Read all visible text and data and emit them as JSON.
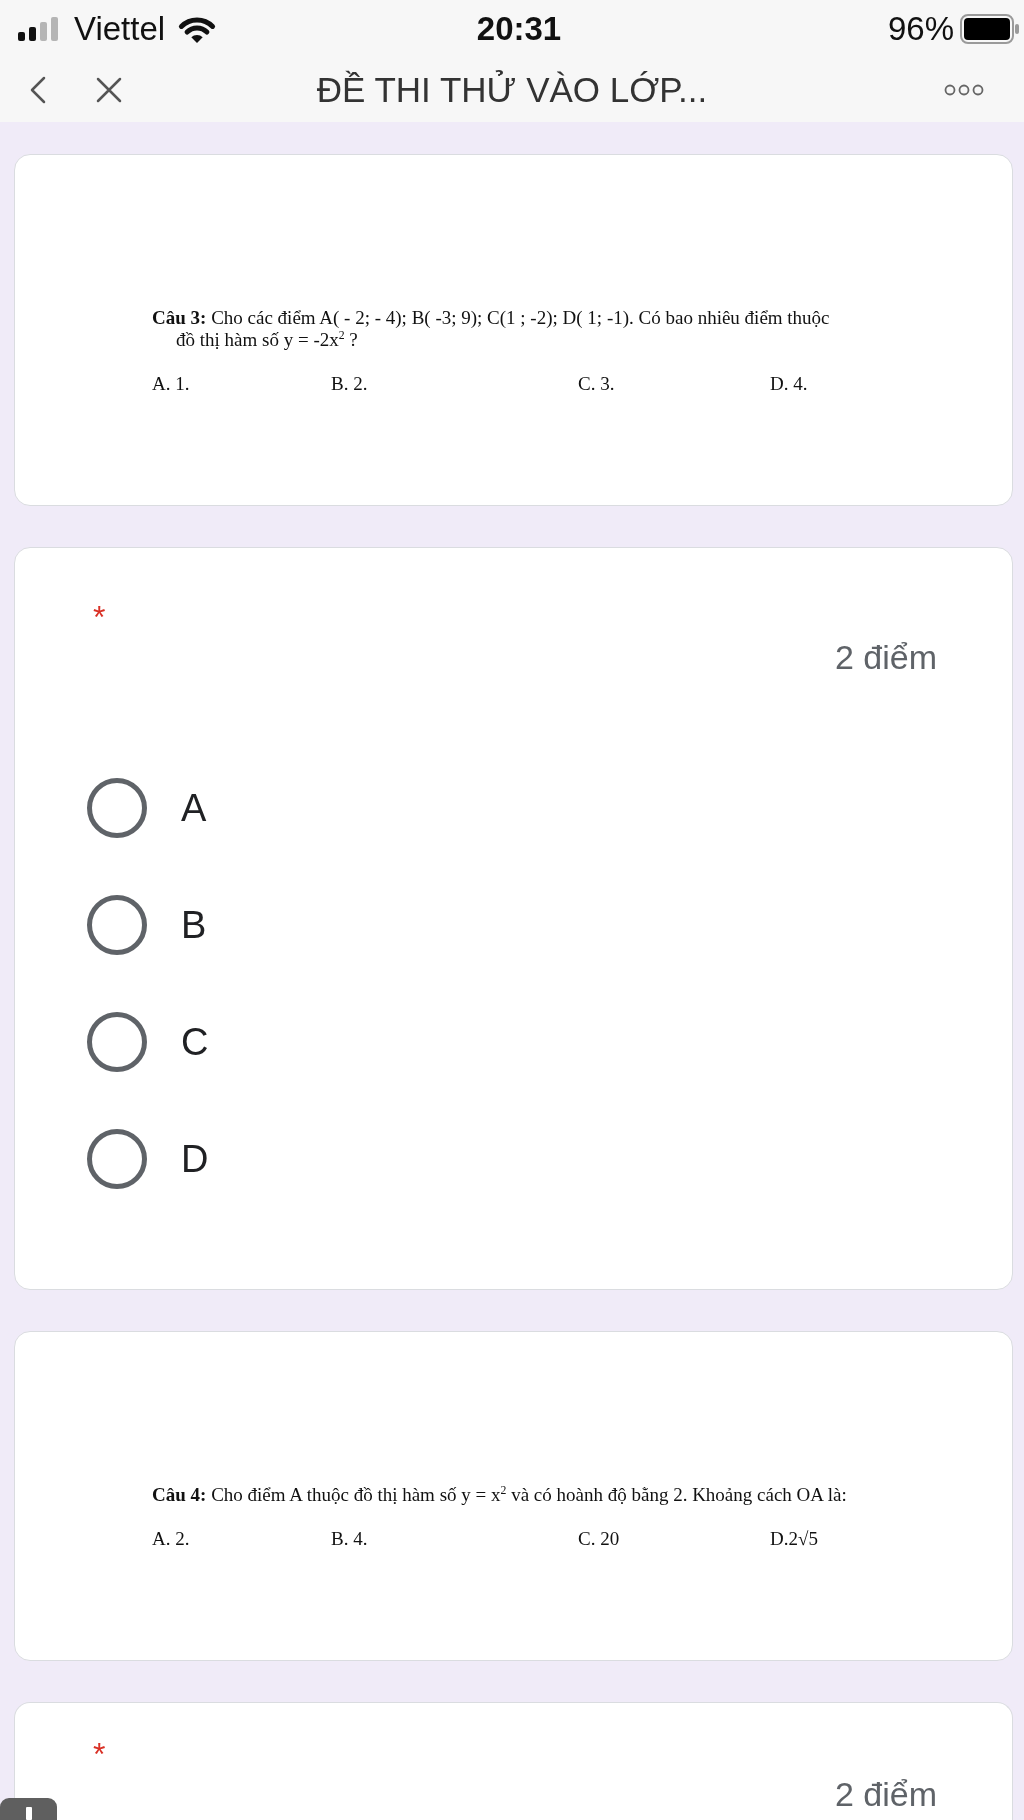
{
  "status_bar": {
    "carrier": "Viettel",
    "time": "20:31",
    "battery": "96%"
  },
  "nav_bar": {
    "title": "ĐỀ THI THỬ VÀO LỚP..."
  },
  "items": [
    {
      "kind": "image_question",
      "lines": [
        "**Câu 3:** Cho các điểm A( - 2; - 4); B( -3; 9); C(1 ; -2); D( 1; -1). Có bao nhiêu điểm thuộc",
        "đồ thị hàm số y = -2x$^{2}$ ?"
      ],
      "options": [
        "A. 1.",
        "B. 2.",
        "C. 3.",
        "D. 4."
      ]
    },
    {
      "kind": "choice_question",
      "required_mark": "*",
      "points": "2 điểm",
      "options": [
        {
          "label": "A",
          "selected": false
        },
        {
          "label": "B",
          "selected": false
        },
        {
          "label": "C",
          "selected": false
        },
        {
          "label": "D",
          "selected": false
        }
      ]
    },
    {
      "kind": "image_question",
      "lines": [
        "**Câu 4:** Cho điểm A thuộc đồ thị hàm số y = x$^{2}$ và có hoành độ bằng 2. Khoảng cách OA là:"
      ],
      "options": [
        "A. 2.",
        "B. 4.",
        "C. 20",
        "D.2√5"
      ]
    },
    {
      "kind": "choice_question",
      "required_mark": "*",
      "points": "2 điểm"
    }
  ]
}
